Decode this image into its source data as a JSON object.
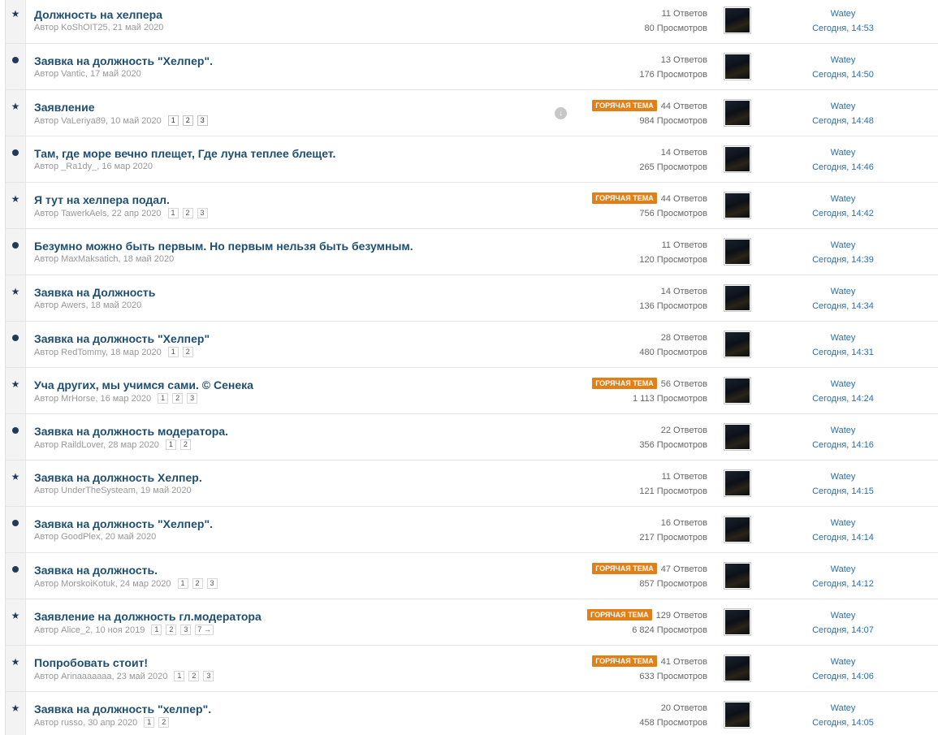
{
  "author_prefix": "Автор",
  "hot_label": "ГОРЯЧАЯ ТЕМА",
  "replies_word": "Ответов",
  "views_word": "Просмотров",
  "colors": {
    "title": "#1f4e73",
    "hot_badge": "#e27f16",
    "link": "#2b6fa7",
    "marker": "#1f3b5a"
  },
  "topics": [
    {
      "marker": "star-icon",
      "title": "Должность на хелпера",
      "author": "KoShOIT25",
      "date": "21 май 2020",
      "pages": [],
      "hot": false,
      "download_icon": false,
      "replies": "11",
      "views": "80",
      "last_user": "Watey",
      "last_time": "Сегодня, 14:53"
    },
    {
      "marker": "dot-icon",
      "title": "Заявка на должность \"Хелпер\".",
      "author": "Vantic",
      "date": "17 май 2020",
      "pages": [],
      "hot": false,
      "download_icon": false,
      "replies": "13",
      "views": "176",
      "last_user": "Watey",
      "last_time": "Сегодня, 14:50"
    },
    {
      "marker": "star-icon",
      "title": "Заявление",
      "author": "VaLeriya89",
      "date": "10 май 2020",
      "pages": [
        "1",
        "2",
        "3"
      ],
      "hot": true,
      "download_icon": true,
      "replies": "44",
      "views": "984",
      "last_user": "Watey",
      "last_time": "Сегодня, 14:48"
    },
    {
      "marker": "dot-icon",
      "title": "Там, где море вечно плещет, Где луна теплее блещет.",
      "author": "_Ra1dy_",
      "date": "16 мар 2020",
      "pages": [],
      "hot": false,
      "download_icon": false,
      "replies": "14",
      "views": "265",
      "last_user": "Watey",
      "last_time": "Сегодня, 14:46"
    },
    {
      "marker": "star-icon",
      "title": "Я тут на хелпера подал.",
      "author": "TawerkAels",
      "date": "22 апр 2020",
      "pages": [
        "1",
        "2",
        "3"
      ],
      "hot": true,
      "download_icon": false,
      "replies": "44",
      "views": "756",
      "last_user": "Watey",
      "last_time": "Сегодня, 14:42"
    },
    {
      "marker": "dot-icon",
      "title": "Безумно можно быть первым. Но первым нельзя быть безумным.",
      "author": "MaxMaksatich",
      "date": "18 май 2020",
      "pages": [],
      "hot": false,
      "download_icon": false,
      "replies": "11",
      "views": "120",
      "last_user": "Watey",
      "last_time": "Сегодня, 14:39"
    },
    {
      "marker": "star-icon",
      "title": "Заявка на Должность",
      "author": "Awers",
      "date": "18 май 2020",
      "pages": [],
      "hot": false,
      "download_icon": false,
      "replies": "14",
      "views": "136",
      "last_user": "Watey",
      "last_time": "Сегодня, 14:34"
    },
    {
      "marker": "dot-icon",
      "title": "Заявка на должность \"Хелпер\"",
      "author": "RedTommy",
      "date": "18 мар 2020",
      "pages": [
        "1",
        "2"
      ],
      "hot": false,
      "download_icon": false,
      "replies": "28",
      "views": "480",
      "last_user": "Watey",
      "last_time": "Сегодня, 14:31"
    },
    {
      "marker": "star-icon",
      "title": "Уча других, мы учимся сами. © Сенека",
      "author": "MrHorse",
      "date": "16 мар 2020",
      "pages": [
        "1",
        "2",
        "3"
      ],
      "hot": true,
      "download_icon": false,
      "replies": "56",
      "views": "1 113",
      "last_user": "Watey",
      "last_time": "Сегодня, 14:24"
    },
    {
      "marker": "dot-icon",
      "title": "Заявка на должность модератора.",
      "author": "RaildLover",
      "date": "28 мар 2020",
      "pages": [
        "1",
        "2"
      ],
      "hot": false,
      "download_icon": false,
      "replies": "22",
      "views": "356",
      "last_user": "Watey",
      "last_time": "Сегодня, 14:16"
    },
    {
      "marker": "star-icon",
      "title": "Заявка на должность Хелпер.",
      "author": "UnderTheSysteam",
      "date": "19 май 2020",
      "pages": [],
      "hot": false,
      "download_icon": false,
      "replies": "11",
      "views": "121",
      "last_user": "Watey",
      "last_time": "Сегодня, 14:15"
    },
    {
      "marker": "dot-icon",
      "title": "Заявка на должность \"Хелпер\".",
      "author": "GoodPlex",
      "date": "20 май 2020",
      "pages": [],
      "hot": false,
      "download_icon": false,
      "replies": "16",
      "views": "217",
      "last_user": "Watey",
      "last_time": "Сегодня, 14:14"
    },
    {
      "marker": "dot-icon",
      "title": "Заявка на должность.",
      "author": "MorskoiKotuk",
      "date": "24 мар 2020",
      "pages": [
        "1",
        "2",
        "3"
      ],
      "hot": true,
      "download_icon": false,
      "replies": "47",
      "views": "857",
      "last_user": "Watey",
      "last_time": "Сегодня, 14:12"
    },
    {
      "marker": "star-icon",
      "title": "Заявление на должность гл.модератора",
      "author": "Alice_2",
      "date": "10 ноя 2019",
      "pages": [
        "1",
        "2",
        "3",
        "7 →"
      ],
      "hot": true,
      "download_icon": false,
      "replies": "129",
      "views": "6 824",
      "last_user": "Watey",
      "last_time": "Сегодня, 14:07"
    },
    {
      "marker": "star-icon",
      "title": "Попробовать стоит!",
      "author": "Arinaaaaaaa",
      "date": "23 май 2020",
      "pages": [
        "1",
        "2",
        "3"
      ],
      "hot": true,
      "download_icon": false,
      "replies": "41",
      "views": "633",
      "last_user": "Watey",
      "last_time": "Сегодня, 14:06"
    },
    {
      "marker": "star-icon",
      "title": "Заявка на должность \"хелпер\".",
      "author": "russo",
      "date": "30 апр 2020",
      "pages": [
        "1",
        "2"
      ],
      "hot": false,
      "download_icon": false,
      "replies": "20",
      "views": "458",
      "last_user": "Watey",
      "last_time": "Сегодня, 14:05"
    }
  ]
}
